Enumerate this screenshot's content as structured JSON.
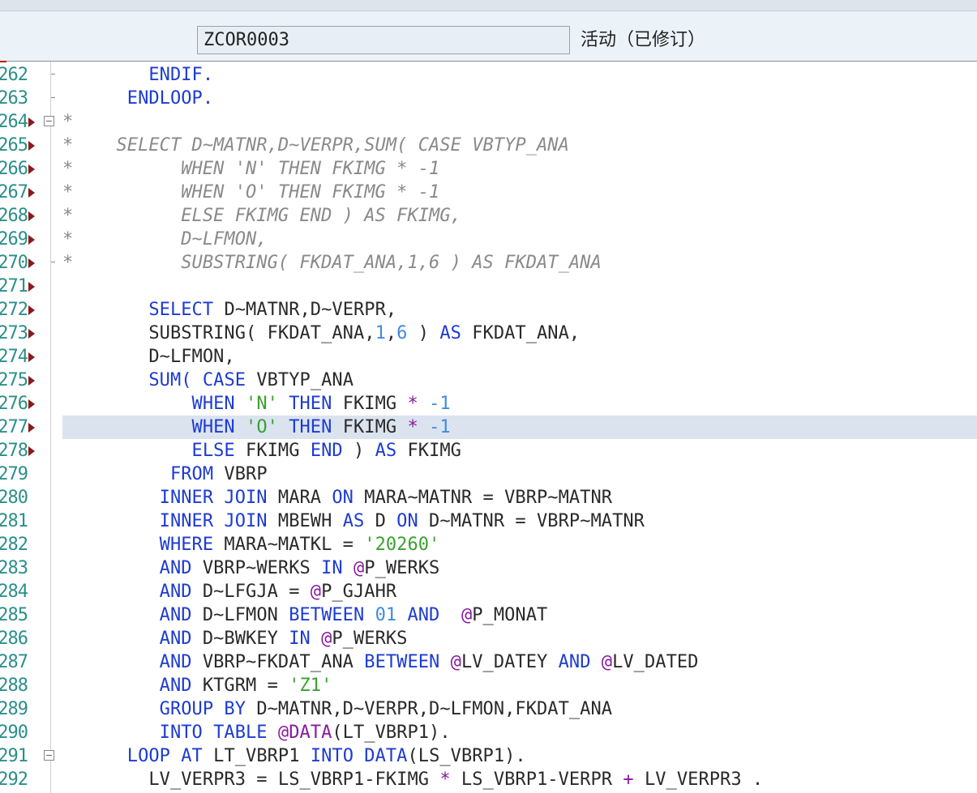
{
  "header": {
    "program_name": "ZCOR0003",
    "status": "活动（已修订）"
  },
  "editor": {
    "highlighted_line": "277",
    "lines": [
      {
        "num": "262",
        "marker": "tick",
        "bp": false,
        "tokens": [
          {
            "t": "        ",
            "c": "tx"
          },
          {
            "t": "ENDIF.",
            "c": "kw"
          }
        ]
      },
      {
        "num": "263",
        "marker": "tick",
        "bp": false,
        "tokens": [
          {
            "t": "      ",
            "c": "tx"
          },
          {
            "t": "ENDLOOP.",
            "c": "kw"
          }
        ]
      },
      {
        "num": "264",
        "marker": "fold",
        "bp": true,
        "tokens": [
          {
            "t": "*",
            "c": "cm"
          }
        ]
      },
      {
        "num": "265",
        "marker": "",
        "bp": true,
        "tokens": [
          {
            "t": "*    SELECT D~MATNR,D~VERPR,SUM( CASE VBTYP_ANA",
            "c": "cm"
          }
        ]
      },
      {
        "num": "266",
        "marker": "",
        "bp": true,
        "tokens": [
          {
            "t": "*          WHEN 'N' THEN FKIMG * -1",
            "c": "cm"
          }
        ]
      },
      {
        "num": "267",
        "marker": "",
        "bp": true,
        "tokens": [
          {
            "t": "*          WHEN 'O' THEN FKIMG * -1",
            "c": "cm"
          }
        ]
      },
      {
        "num": "268",
        "marker": "",
        "bp": true,
        "tokens": [
          {
            "t": "*          ELSE FKIMG END ) AS FKIMG,",
            "c": "cm"
          }
        ]
      },
      {
        "num": "269",
        "marker": "",
        "bp": true,
        "tokens": [
          {
            "t": "*          D~LFMON,",
            "c": "cm"
          }
        ]
      },
      {
        "num": "270",
        "marker": "tick",
        "bp": true,
        "tokens": [
          {
            "t": "*          SUBSTRING( FKDAT_ANA,1,6 ) AS FKDAT_ANA",
            "c": "cm"
          }
        ]
      },
      {
        "num": "271",
        "marker": "",
        "bp": true,
        "tokens": []
      },
      {
        "num": "272",
        "marker": "",
        "bp": true,
        "tokens": [
          {
            "t": "        ",
            "c": "tx"
          },
          {
            "t": "SELECT",
            "c": "kw"
          },
          {
            "t": " D~MATNR,D~VERPR,",
            "c": "tx"
          }
        ]
      },
      {
        "num": "273",
        "marker": "",
        "bp": true,
        "tokens": [
          {
            "t": "        SUBSTRING( FKDAT_ANA,",
            "c": "tx"
          },
          {
            "t": "1",
            "c": "num"
          },
          {
            "t": ",",
            "c": "tx"
          },
          {
            "t": "6",
            "c": "num"
          },
          {
            "t": " ) ",
            "c": "tx"
          },
          {
            "t": "AS",
            "c": "kw"
          },
          {
            "t": " FKDAT_ANA,",
            "c": "tx"
          }
        ]
      },
      {
        "num": "274",
        "marker": "",
        "bp": true,
        "tokens": [
          {
            "t": "        D~LFMON,",
            "c": "tx"
          }
        ]
      },
      {
        "num": "275",
        "marker": "",
        "bp": true,
        "tokens": [
          {
            "t": "        ",
            "c": "tx"
          },
          {
            "t": "SUM(",
            "c": "kw"
          },
          {
            "t": " ",
            "c": "tx"
          },
          {
            "t": "CASE",
            "c": "kw"
          },
          {
            "t": " VBTYP_ANA",
            "c": "tx"
          }
        ]
      },
      {
        "num": "276",
        "marker": "",
        "bp": true,
        "tokens": [
          {
            "t": "            ",
            "c": "tx"
          },
          {
            "t": "WHEN",
            "c": "kw"
          },
          {
            "t": " ",
            "c": "tx"
          },
          {
            "t": "'N'",
            "c": "str"
          },
          {
            "t": " ",
            "c": "tx"
          },
          {
            "t": "THEN",
            "c": "kw"
          },
          {
            "t": " FKIMG ",
            "c": "tx"
          },
          {
            "t": "*",
            "c": "op"
          },
          {
            "t": " ",
            "c": "tx"
          },
          {
            "t": "-1",
            "c": "num"
          }
        ]
      },
      {
        "num": "277",
        "marker": "",
        "bp": true,
        "tokens": [
          {
            "t": "            ",
            "c": "tx"
          },
          {
            "t": "WHEN",
            "c": "kw"
          },
          {
            "t": " ",
            "c": "tx"
          },
          {
            "t": "'O'",
            "c": "str"
          },
          {
            "t": " ",
            "c": "tx"
          },
          {
            "t": "THEN",
            "c": "kw"
          },
          {
            "t": " FKIMG ",
            "c": "tx"
          },
          {
            "t": "*",
            "c": "op"
          },
          {
            "t": " ",
            "c": "tx"
          },
          {
            "t": "-1",
            "c": "num"
          }
        ]
      },
      {
        "num": "278",
        "marker": "",
        "bp": true,
        "tokens": [
          {
            "t": "            ",
            "c": "tx"
          },
          {
            "t": "ELSE",
            "c": "kw"
          },
          {
            "t": " FKIMG ",
            "c": "tx"
          },
          {
            "t": "END",
            "c": "kw"
          },
          {
            "t": " ) ",
            "c": "tx"
          },
          {
            "t": "AS",
            "c": "kw"
          },
          {
            "t": " FKIMG",
            "c": "tx"
          }
        ]
      },
      {
        "num": "279",
        "marker": "",
        "bp": false,
        "tokens": [
          {
            "t": "          ",
            "c": "tx"
          },
          {
            "t": "FROM",
            "c": "kw"
          },
          {
            "t": " VBRP",
            "c": "tx"
          }
        ]
      },
      {
        "num": "280",
        "marker": "",
        "bp": false,
        "tokens": [
          {
            "t": "         ",
            "c": "tx"
          },
          {
            "t": "INNER JOIN",
            "c": "kw"
          },
          {
            "t": " MARA ",
            "c": "tx"
          },
          {
            "t": "ON",
            "c": "kw"
          },
          {
            "t": " MARA~MATNR = VBRP~MATNR",
            "c": "tx"
          }
        ]
      },
      {
        "num": "281",
        "marker": "",
        "bp": false,
        "tokens": [
          {
            "t": "         ",
            "c": "tx"
          },
          {
            "t": "INNER JOIN",
            "c": "kw"
          },
          {
            "t": " MBEWH ",
            "c": "tx"
          },
          {
            "t": "AS",
            "c": "kw"
          },
          {
            "t": " D ",
            "c": "tx"
          },
          {
            "t": "ON",
            "c": "kw"
          },
          {
            "t": " D~MATNR = VBRP~MATNR",
            "c": "tx"
          }
        ]
      },
      {
        "num": "282",
        "marker": "",
        "bp": false,
        "tokens": [
          {
            "t": "         ",
            "c": "tx"
          },
          {
            "t": "WHERE",
            "c": "kw"
          },
          {
            "t": " MARA~MATKL = ",
            "c": "tx"
          },
          {
            "t": "'20260'",
            "c": "str"
          }
        ]
      },
      {
        "num": "283",
        "marker": "",
        "bp": false,
        "tokens": [
          {
            "t": "         ",
            "c": "tx"
          },
          {
            "t": "AND",
            "c": "kw"
          },
          {
            "t": " VBRP~WERKS ",
            "c": "tx"
          },
          {
            "t": "IN",
            "c": "kw"
          },
          {
            "t": " ",
            "c": "tx"
          },
          {
            "t": "@",
            "c": "op"
          },
          {
            "t": "P_WERKS",
            "c": "tx"
          }
        ]
      },
      {
        "num": "284",
        "marker": "",
        "bp": false,
        "tokens": [
          {
            "t": "         ",
            "c": "tx"
          },
          {
            "t": "AND",
            "c": "kw"
          },
          {
            "t": " D~LFGJA = ",
            "c": "tx"
          },
          {
            "t": "@",
            "c": "op"
          },
          {
            "t": "P_GJAHR",
            "c": "tx"
          }
        ]
      },
      {
        "num": "285",
        "marker": "",
        "bp": false,
        "tokens": [
          {
            "t": "         ",
            "c": "tx"
          },
          {
            "t": "AND",
            "c": "kw"
          },
          {
            "t": " D~LFMON ",
            "c": "tx"
          },
          {
            "t": "BETWEEN",
            "c": "kw"
          },
          {
            "t": " ",
            "c": "tx"
          },
          {
            "t": "01",
            "c": "num"
          },
          {
            "t": " ",
            "c": "tx"
          },
          {
            "t": "AND",
            "c": "kw"
          },
          {
            "t": "  ",
            "c": "tx"
          },
          {
            "t": "@",
            "c": "op"
          },
          {
            "t": "P_MONAT",
            "c": "tx"
          }
        ]
      },
      {
        "num": "286",
        "marker": "",
        "bp": false,
        "tokens": [
          {
            "t": "         ",
            "c": "tx"
          },
          {
            "t": "AND",
            "c": "kw"
          },
          {
            "t": " D~BWKEY ",
            "c": "tx"
          },
          {
            "t": "IN",
            "c": "kw"
          },
          {
            "t": " ",
            "c": "tx"
          },
          {
            "t": "@",
            "c": "op"
          },
          {
            "t": "P_WERKS",
            "c": "tx"
          }
        ]
      },
      {
        "num": "287",
        "marker": "",
        "bp": false,
        "tokens": [
          {
            "t": "         ",
            "c": "tx"
          },
          {
            "t": "AND",
            "c": "kw"
          },
          {
            "t": " VBRP~FKDAT_ANA ",
            "c": "tx"
          },
          {
            "t": "BETWEEN",
            "c": "kw"
          },
          {
            "t": " ",
            "c": "tx"
          },
          {
            "t": "@",
            "c": "op"
          },
          {
            "t": "LV_DATEY ",
            "c": "tx"
          },
          {
            "t": "AND",
            "c": "kw"
          },
          {
            "t": " ",
            "c": "tx"
          },
          {
            "t": "@",
            "c": "op"
          },
          {
            "t": "LV_DATED",
            "c": "tx"
          }
        ]
      },
      {
        "num": "288",
        "marker": "",
        "bp": false,
        "tokens": [
          {
            "t": "         ",
            "c": "tx"
          },
          {
            "t": "AND",
            "c": "kw"
          },
          {
            "t": " KTGRM = ",
            "c": "tx"
          },
          {
            "t": "'Z1'",
            "c": "str"
          }
        ]
      },
      {
        "num": "289",
        "marker": "",
        "bp": false,
        "tokens": [
          {
            "t": "         ",
            "c": "tx"
          },
          {
            "t": "GROUP BY",
            "c": "kw"
          },
          {
            "t": " D~MATNR,D~VERPR,D~LFMON,FKDAT_ANA",
            "c": "tx"
          }
        ]
      },
      {
        "num": "290",
        "marker": "",
        "bp": false,
        "tokens": [
          {
            "t": "         ",
            "c": "tx"
          },
          {
            "t": "INTO TABLE",
            "c": "kw"
          },
          {
            "t": " ",
            "c": "tx"
          },
          {
            "t": "@DATA",
            "c": "op"
          },
          {
            "t": "(LT_VBRP1).",
            "c": "tx"
          }
        ]
      },
      {
        "num": "291",
        "marker": "fold",
        "bp": false,
        "tokens": [
          {
            "t": "      ",
            "c": "tx"
          },
          {
            "t": "LOOP AT",
            "c": "kw"
          },
          {
            "t": " LT_VBRP1 ",
            "c": "tx"
          },
          {
            "t": "INTO",
            "c": "kw"
          },
          {
            "t": " ",
            "c": "tx"
          },
          {
            "t": "DATA",
            "c": "kw"
          },
          {
            "t": "(LS_VBRP1).",
            "c": "tx"
          }
        ]
      },
      {
        "num": "292",
        "marker": "",
        "bp": false,
        "tokens": [
          {
            "t": "        LV_VERPR3 = LS_VBRP1-FKIMG ",
            "c": "tx"
          },
          {
            "t": "*",
            "c": "op"
          },
          {
            "t": " LS_VBRP1-VERPR ",
            "c": "tx"
          },
          {
            "t": "+",
            "c": "op"
          },
          {
            "t": " LV_VERPR3 .",
            "c": "tx"
          }
        ]
      }
    ]
  }
}
